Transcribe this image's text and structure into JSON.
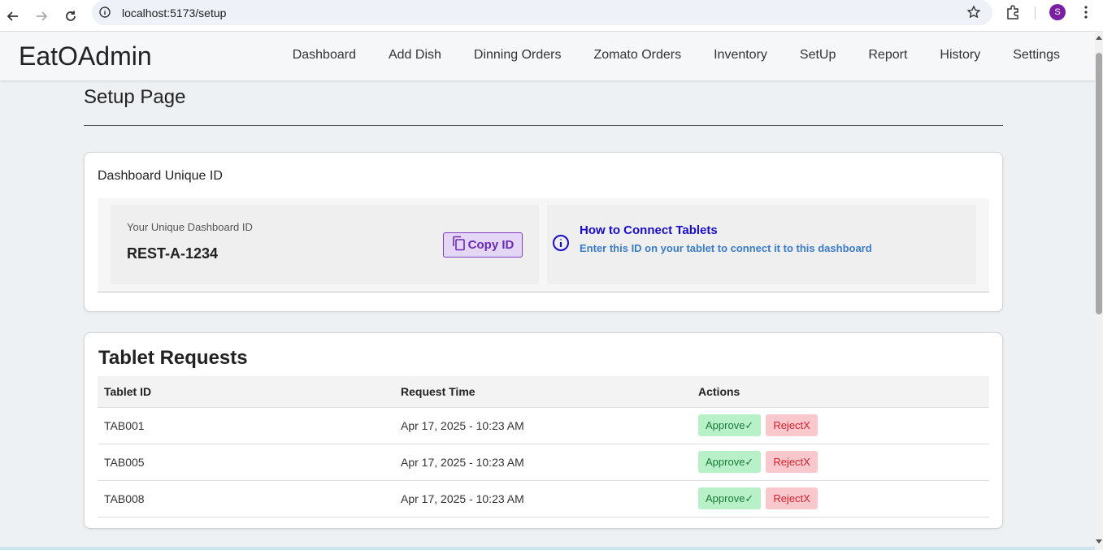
{
  "browser": {
    "url": "localhost:5173/setup",
    "profile_initial": "S"
  },
  "app": {
    "brand": "EatOAdmin",
    "nav": [
      "Dashboard",
      "Add Dish",
      "Dinning Orders",
      "Zomato Orders",
      "Inventory",
      "SetUp",
      "Report",
      "History",
      "Settings"
    ]
  },
  "page": {
    "title": "Setup Page"
  },
  "dashboard_id_card": {
    "title": "Dashboard Unique ID",
    "id_label": "Your Unique Dashboard ID",
    "id_value": "REST-A-1234",
    "copy_label": "Copy ID",
    "info_title": "How to Connect Tablets",
    "info_desc": "Enter this ID on your tablet to connect it to this dashboard"
  },
  "tablet_requests": {
    "title": "Tablet Requests",
    "columns": [
      "Tablet ID",
      "Request Time",
      "Actions"
    ],
    "approve_label": "Approve✓",
    "reject_label": "RejectX",
    "rows": [
      {
        "tablet_id": "TAB001",
        "time": "Apr 17, 2025 - 10:23 AM"
      },
      {
        "tablet_id": "TAB005",
        "time": "Apr 17, 2025 - 10:23 AM"
      },
      {
        "tablet_id": "TAB008",
        "time": "Apr 17, 2025 - 10:23 AM"
      }
    ]
  },
  "colors": {
    "accent_purple": "#7e3fc6",
    "approve_bg": "#b8f0c8",
    "reject_bg": "#f8c8cc",
    "info_title": "#1a0dc9"
  }
}
